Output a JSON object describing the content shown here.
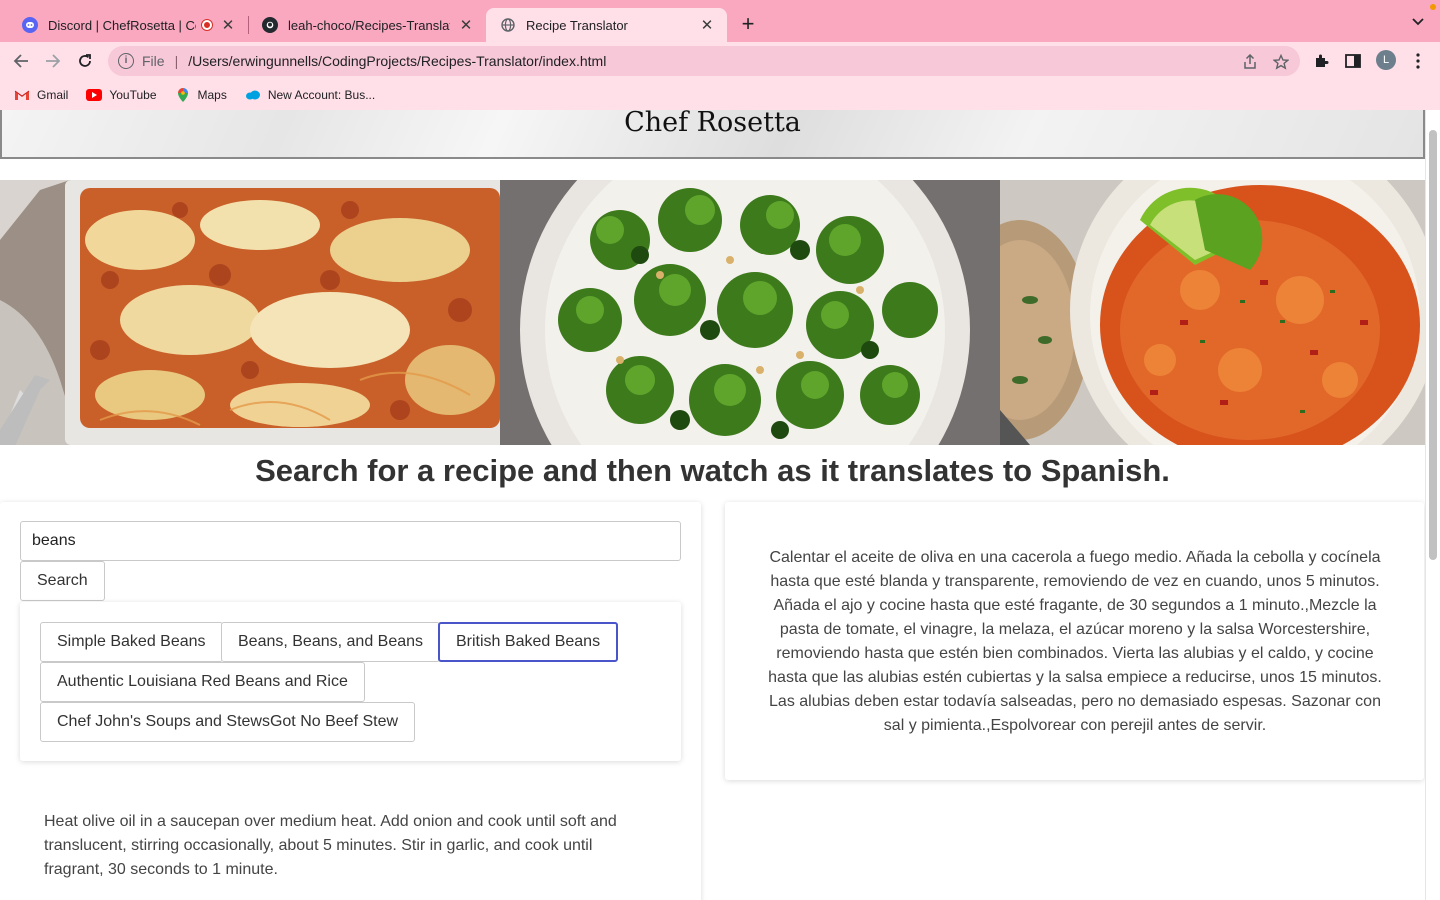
{
  "browser": {
    "tabs": [
      {
        "title": "Discord | ChefRosetta | Co",
        "icon": "discord-icon",
        "recording": true
      },
      {
        "title": "leah-choco/Recipes-Translator",
        "icon": "github-icon"
      },
      {
        "title": "Recipe Translator",
        "icon": "globe-icon",
        "active": true
      }
    ],
    "address": {
      "scheme": "File",
      "path": "/Users/erwingunnells/CodingProjects/Recipes-Translator/index.html"
    },
    "profile_initial": "L",
    "bookmarks": [
      {
        "label": "Gmail",
        "icon": "gmail-icon"
      },
      {
        "label": "YouTube",
        "icon": "youtube-icon"
      },
      {
        "label": "Maps",
        "icon": "maps-icon"
      },
      {
        "label": "New Account: Bus...",
        "icon": "salesforce-icon"
      }
    ]
  },
  "page": {
    "site_title": "Chef Rosetta",
    "hero_images": [
      "baked-spaghetti-image",
      "roasted-broccoli-image",
      "spanish-rice-image"
    ],
    "tagline": "Search for a recipe and then watch as it translates to Spanish.",
    "search": {
      "value": "beans",
      "button_label": "Search"
    },
    "results": [
      {
        "label": "Simple Baked Beans"
      },
      {
        "label": "Beans, Beans, and Beans"
      },
      {
        "label": "British Baked Beans",
        "selected": true
      },
      {
        "label": "Authentic Louisiana Red Beans and Rice"
      },
      {
        "label": "Chef John's Soups and StewsGot No Beef Stew"
      }
    ],
    "english_instructions": "Heat olive oil in a saucepan over medium heat. Add onion and cook until soft and translucent, stirring occasionally, about 5 minutes. Stir in garlic, and cook until fragrant, 30 seconds to 1 minute.",
    "spanish_instructions": "Calentar el aceite de oliva en una cacerola a fuego medio. Añada la cebolla y cocínela hasta que esté blanda y transparente, removiendo de vez en cuando, unos 5 minutos. Añada el ajo y cocine hasta que esté fragante, de 30 segundos a 1 minuto.,Mezcle la pasta de tomate, el vinagre, la melaza, el azúcar moreno y la salsa Worcestershire, removiendo hasta que estén bien combinados. Vierta las alubias y el caldo, y cocine hasta que las alubias estén cubiertas y la salsa empiece a reducirse, unos 15 minutos. Las alubias deben estar todavía salseadas, pero no demasiado espesas. Sazonar con sal y pimienta.,Espolvorear con perejil antes de servir."
  },
  "colors": {
    "tabstrip": "#f9a8c0",
    "toolbar": "#ffe0e9",
    "selected_border": "#4a55c9"
  }
}
